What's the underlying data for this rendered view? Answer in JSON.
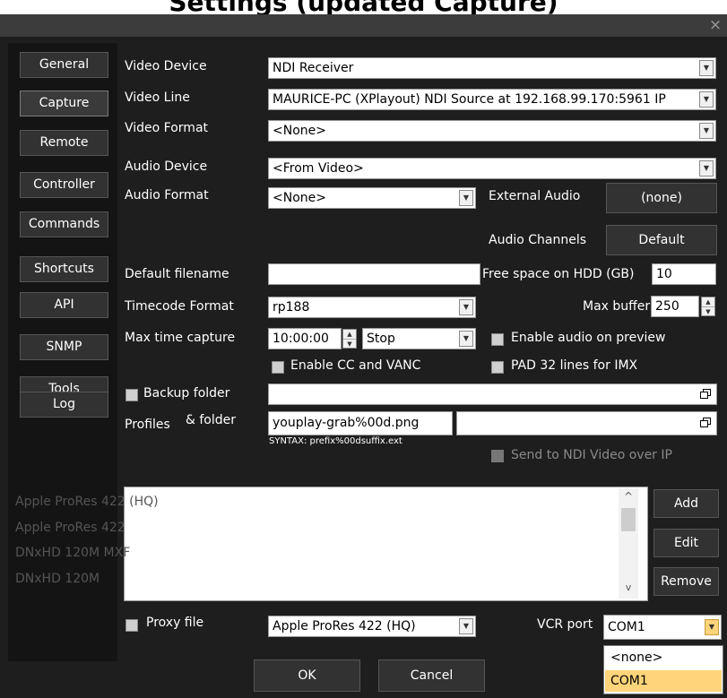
{
  "window": {
    "title": "Settings (updated Capture)",
    "close_glyph": "×"
  },
  "sidebar": {
    "items": [
      {
        "label": "General"
      },
      {
        "label": "Capture"
      },
      {
        "label": "Remote"
      },
      {
        "label": "Controller"
      },
      {
        "label": "Commands"
      },
      {
        "label": "Shortcuts"
      },
      {
        "label": "API"
      },
      {
        "label": "SNMP"
      },
      {
        "label": "Tools"
      },
      {
        "label": "Log"
      }
    ]
  },
  "form": {
    "video_device": {
      "label": "Video Device",
      "value": "NDI Receiver"
    },
    "video_line": {
      "label": "Video Line",
      "value": "MAURICE-PC (XPlayout) NDI Source at 192.168.99.170:5961 IP"
    },
    "video_format": {
      "label": "Video Format",
      "value": "<None>"
    },
    "audio_device": {
      "label": "Audio Device",
      "value": "<From Video>"
    },
    "audio_format": {
      "label": "Audio Format",
      "value": "<None>"
    },
    "external_audio": {
      "label": "External Audio",
      "button": "(none)"
    },
    "audio_channels": {
      "label": "Audio Channels",
      "button": "Default"
    },
    "default_filename": {
      "label": "Default filename",
      "value": ""
    },
    "free_space": {
      "label": "Free space on HDD (GB)",
      "value": "10"
    },
    "timecode_format": {
      "label": "Timecode Format",
      "value": "rp188"
    },
    "max_buffer": {
      "label": "Max buffer",
      "value": "250"
    },
    "max_time_capture": {
      "label": "Max time capture",
      "time": "10:00:00",
      "action": "Stop"
    },
    "enable_audio_preview": {
      "label": "Enable audio on preview",
      "checked": false
    },
    "enable_cc_vanc": {
      "label": "Enable CC and VANC",
      "checked": false
    },
    "pad_32_lines": {
      "label": "PAD 32 lines for IMX",
      "checked": false
    },
    "backup_folder": {
      "label": "Backup folder",
      "checked": false,
      "value": ""
    },
    "profiles": {
      "label": "Profiles",
      "folder_label": "& folder",
      "pattern": "youplay-grab%00d.png",
      "folder_value": "",
      "syntax": "SYNTAX: prefix%00dsuffix.ext"
    },
    "send_ndi": {
      "label": "Send to NDI Video over IP",
      "checked": false
    },
    "profile_list": [
      "Apple ProRes 422 (HQ)",
      "Apple ProRes 422",
      "DNxHD 120M MXF",
      "DNxHD 120M"
    ],
    "list_buttons": {
      "add": "Add",
      "edit": "Edit",
      "remove": "Remove"
    },
    "proxy_file": {
      "label": "Proxy file",
      "checked": false,
      "value": "Apple ProRes 422 (HQ)"
    },
    "vcr_port": {
      "label": "VCR port",
      "value": "COM1",
      "options": [
        "<none>",
        "COM1"
      ],
      "selected": "COM1"
    }
  },
  "footer": {
    "ok": "OK",
    "cancel": "Cancel"
  },
  "colors": {
    "dialog_bg": "#1e1e1e",
    "sidebar_bg": "#141414",
    "button_bg": "#323232",
    "dropdown_highlight": "#ffd47a"
  }
}
